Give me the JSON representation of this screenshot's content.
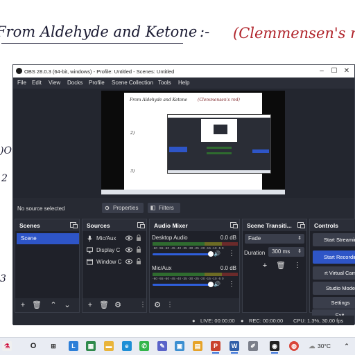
{
  "background": {
    "handwriting_line": "From Aldehyde and Ketone",
    "handwriting_dash": ":-",
    "handwriting_red": "(Clemmensen's re"
  },
  "window": {
    "title": "OBS 28.0.3 (64-bit, windows) - Profile: Untitled - Scenes: Untitled",
    "menu": [
      "File",
      "Edit",
      "View",
      "Docks",
      "Profile",
      "Scene Collection",
      "Tools",
      "Help"
    ]
  },
  "preview": {
    "page_line_1": "From Aldehyde and Ketone",
    "page_line_2": "(Clemmensen's red)"
  },
  "source_bar": {
    "no_source": "No source selected",
    "properties": "Properties",
    "filters": "Filters"
  },
  "scenes": {
    "title": "Scenes",
    "items": [
      "Scene"
    ]
  },
  "sources": {
    "title": "Sources",
    "items": [
      {
        "label": "Mic/Aux",
        "icon": "mic-icon"
      },
      {
        "label": "Display C",
        "icon": "display-icon"
      },
      {
        "label": "Window C",
        "icon": "window-icon"
      }
    ]
  },
  "audio_mixer": {
    "title": "Audio Mixer",
    "channels": [
      {
        "name": "Desktop Audio",
        "level": "0.0 dB",
        "volume_fraction": 1.0
      },
      {
        "name": "Mic/Aux",
        "level": "0.0 dB",
        "volume_fraction": 1.0
      }
    ],
    "ticks": "-60 -55 -50 -45 -40 -35 -30 -25 -20 -15 -10 -5 0"
  },
  "transitions": {
    "title": "Scene Transiti...",
    "selected": "Fade",
    "duration_label": "Duration",
    "duration_value": "300 ms"
  },
  "controls": {
    "title": "Controls",
    "buttons": [
      "Start Streamin",
      "Start Recordin",
      "rt Virtual Cam",
      "Studio Mode",
      "Settings",
      "Exit"
    ]
  },
  "status": {
    "live": "LIVE: 00:00:00",
    "rec": "REC: 00:00:00",
    "cpu": "CPU: 1.3%, 30.00 fps"
  },
  "taskbar": {
    "search_glyph": "O",
    "weather": "30°C"
  },
  "colors": {
    "accent": "#2e55c7",
    "obs_bg": "#272a33",
    "dock_bg": "#1f2129",
    "handwriting_red": "#b0232a"
  }
}
